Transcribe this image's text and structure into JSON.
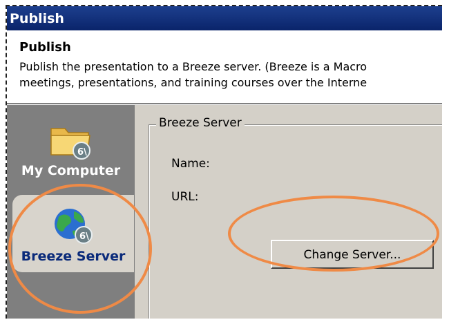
{
  "window": {
    "title": "Publish"
  },
  "header": {
    "title": "Publish",
    "description_line1": "Publish the presentation to a Breeze server. (Breeze is a Macro",
    "description_line2": "meetings, presentations, and training courses over the Interne"
  },
  "sidebar": {
    "items": [
      {
        "label": "My Computer",
        "icon": "folder-icon",
        "selected": false
      },
      {
        "label": "Breeze Server",
        "icon": "globe-icon",
        "selected": true
      }
    ]
  },
  "content": {
    "group_label": "Breeze Server",
    "name_label": "Name:",
    "url_label": "URL:",
    "change_server_button": "Change Server..."
  },
  "colors": {
    "title_bar": "#0a246a",
    "sidebar_bg": "#7f7f7f",
    "panel_bg": "#d4d0c8",
    "annotation_circle": "#ef8a46"
  }
}
